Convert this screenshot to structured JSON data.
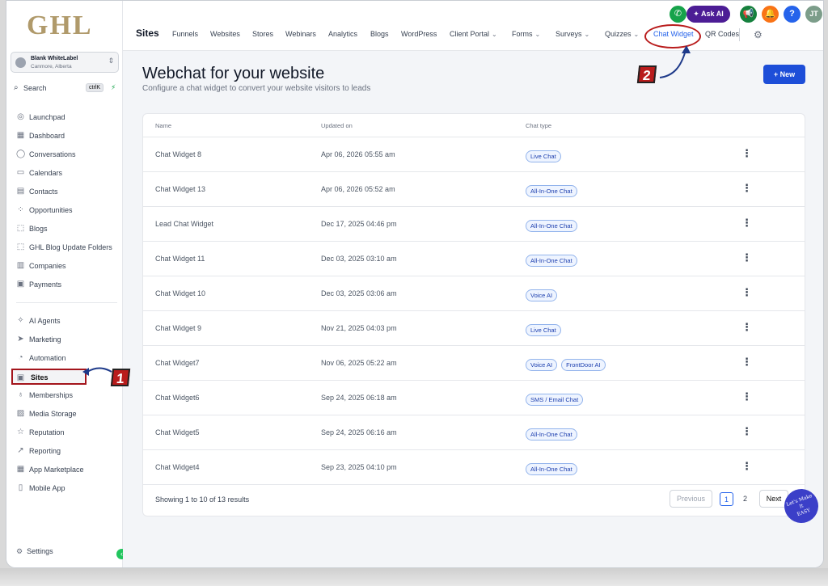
{
  "sidebar": {
    "logo": "GHL",
    "account": {
      "name": "Blank WhiteLabel",
      "location": "Canmore, Alberta"
    },
    "search": {
      "label": "Search",
      "shortcut": "ctrlK"
    },
    "items_top": [
      {
        "label": "Launchpad",
        "icon": "rocket-icon",
        "glyph": "◎"
      },
      {
        "label": "Dashboard",
        "icon": "grid-icon",
        "glyph": "▦"
      },
      {
        "label": "Conversations",
        "icon": "chat-bubble-icon",
        "glyph": "◯"
      },
      {
        "label": "Calendars",
        "icon": "calendar-icon",
        "glyph": "▭"
      },
      {
        "label": "Contacts",
        "icon": "contacts-icon",
        "glyph": "▤"
      },
      {
        "label": "Opportunities",
        "icon": "opportunities-icon",
        "glyph": "⁘"
      },
      {
        "label": "Blogs",
        "icon": "blog-icon",
        "glyph": "⬚"
      },
      {
        "label": "GHL Blog Update Folders",
        "icon": "folder-icon",
        "glyph": "⬚"
      },
      {
        "label": "Companies",
        "icon": "building-icon",
        "glyph": "▥"
      },
      {
        "label": "Payments",
        "icon": "receipt-icon",
        "glyph": "▣"
      }
    ],
    "items_bottom": [
      {
        "label": "AI Agents",
        "icon": "sparkle-icon",
        "glyph": "✧"
      },
      {
        "label": "Marketing",
        "icon": "send-icon",
        "glyph": "➤"
      },
      {
        "label": "Automation",
        "icon": "automation-icon",
        "glyph": "◔"
      },
      {
        "label": "Sites",
        "icon": "sites-icon",
        "glyph": "▣"
      },
      {
        "label": "Memberships",
        "icon": "award-icon",
        "glyph": "♁"
      },
      {
        "label": "Media Storage",
        "icon": "image-icon",
        "glyph": "▨"
      },
      {
        "label": "Reputation",
        "icon": "star-icon",
        "glyph": "☆"
      },
      {
        "label": "Reporting",
        "icon": "trend-icon",
        "glyph": "↗"
      },
      {
        "label": "App Marketplace",
        "icon": "apps-icon",
        "glyph": "▦"
      },
      {
        "label": "Mobile App",
        "icon": "mobile-icon",
        "glyph": "▯"
      }
    ],
    "settings": "Settings"
  },
  "topbar": {
    "ask_ai": "Ask AI",
    "user_initials": "JT",
    "section": "Sites",
    "tabs": [
      {
        "label": "Funnels",
        "caret": false
      },
      {
        "label": "Websites",
        "caret": false
      },
      {
        "label": "Stores",
        "caret": false
      },
      {
        "label": "Webinars",
        "caret": false
      },
      {
        "label": "Analytics",
        "caret": false
      },
      {
        "label": "Blogs",
        "caret": false
      },
      {
        "label": "WordPress",
        "caret": false
      },
      {
        "label": "Client Portal",
        "caret": true
      },
      {
        "label": "Forms",
        "caret": true
      },
      {
        "label": "Surveys",
        "caret": true
      },
      {
        "label": "Quizzes",
        "caret": true
      },
      {
        "label": "Chat Widget",
        "caret": false,
        "active": true
      },
      {
        "label": "QR Codes",
        "caret": false
      }
    ]
  },
  "annotations": {
    "step1": "1",
    "step2": "2",
    "watermark": "Let's Make It EASY"
  },
  "main": {
    "title": "Webchat for your website",
    "subtitle": "Configure a chat widget to convert your website visitors to leads",
    "new_button": "+ New",
    "columns": [
      "Name",
      "Updated on",
      "Chat type"
    ],
    "rows": [
      {
        "name": "Chat Widget 8",
        "updated": "Apr 06, 2026 05:55 am",
        "types": [
          "Live Chat"
        ]
      },
      {
        "name": "Chat Widget 13",
        "updated": "Apr 06, 2026 05:52 am",
        "types": [
          "All-In-One Chat"
        ]
      },
      {
        "name": "Lead Chat Widget",
        "updated": "Dec 17, 2025 04:46 pm",
        "types": [
          "All-In-One Chat"
        ]
      },
      {
        "name": "Chat Widget 11",
        "updated": "Dec 03, 2025 03:10 am",
        "types": [
          "All-In-One Chat"
        ]
      },
      {
        "name": "Chat Widget 10",
        "updated": "Dec 03, 2025 03:06 am",
        "types": [
          "Voice AI"
        ]
      },
      {
        "name": "Chat Widget 9",
        "updated": "Nov 21, 2025 04:03 pm",
        "types": [
          "Live Chat"
        ]
      },
      {
        "name": "Chat Widget7",
        "updated": "Nov 06, 2025 05:22 am",
        "types": [
          "Voice AI",
          "FrontDoor AI"
        ]
      },
      {
        "name": "Chat Widget6",
        "updated": "Sep 24, 2025 06:18 am",
        "types": [
          "SMS / Email Chat"
        ]
      },
      {
        "name": "Chat Widget5",
        "updated": "Sep 24, 2025 06:16 am",
        "types": [
          "All-In-One Chat"
        ]
      },
      {
        "name": "Chat Widget4",
        "updated": "Sep 23, 2025 04:10 pm",
        "types": [
          "All-In-One Chat"
        ]
      }
    ],
    "pagination": {
      "showing": "Showing 1 to 10 of 13 results",
      "previous": "Previous",
      "pages": [
        "1",
        "2"
      ],
      "current": "1",
      "next": "Next"
    }
  },
  "colors": {
    "accent": "#1d4ed8",
    "annotation": "#b91c1c",
    "ask_ai": "#4c1d95",
    "logo": "#b09a6b"
  }
}
